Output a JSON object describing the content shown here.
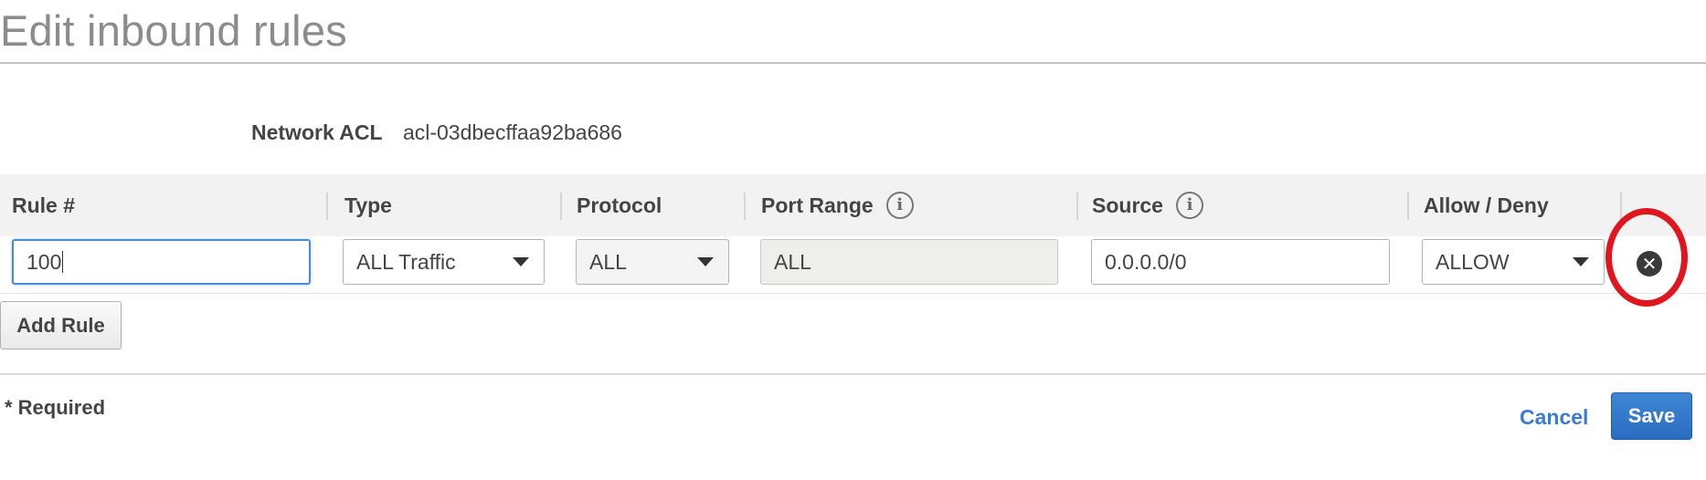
{
  "page": {
    "title": "Edit inbound rules"
  },
  "acl": {
    "label": "Network ACL",
    "value": "acl-03dbecffaa92ba686"
  },
  "table": {
    "headers": {
      "rule_num": "Rule #",
      "type": "Type",
      "protocol": "Protocol",
      "port_range": "Port Range",
      "source": "Source",
      "allow_deny": "Allow / Deny"
    },
    "info_icon_glyph": "i",
    "rows": [
      {
        "rule_num": "100",
        "type": "ALL Traffic",
        "protocol": "ALL",
        "port_range": "ALL",
        "source": "0.0.0.0/0",
        "allow_deny": "ALLOW",
        "remove_glyph": "✕"
      }
    ]
  },
  "actions": {
    "add_rule": "Add Rule",
    "required_note": "* Required",
    "cancel": "Cancel",
    "save": "Save"
  },
  "colors": {
    "accent_blue": "#2a6cc1",
    "link_blue": "#3b7bd4",
    "highlight_red": "#e0161e",
    "focus_blue": "#4a8bd9"
  },
  "icons": {
    "info": "info-icon",
    "remove": "remove-rule-icon",
    "dropdown": "chevron-down-icon"
  }
}
